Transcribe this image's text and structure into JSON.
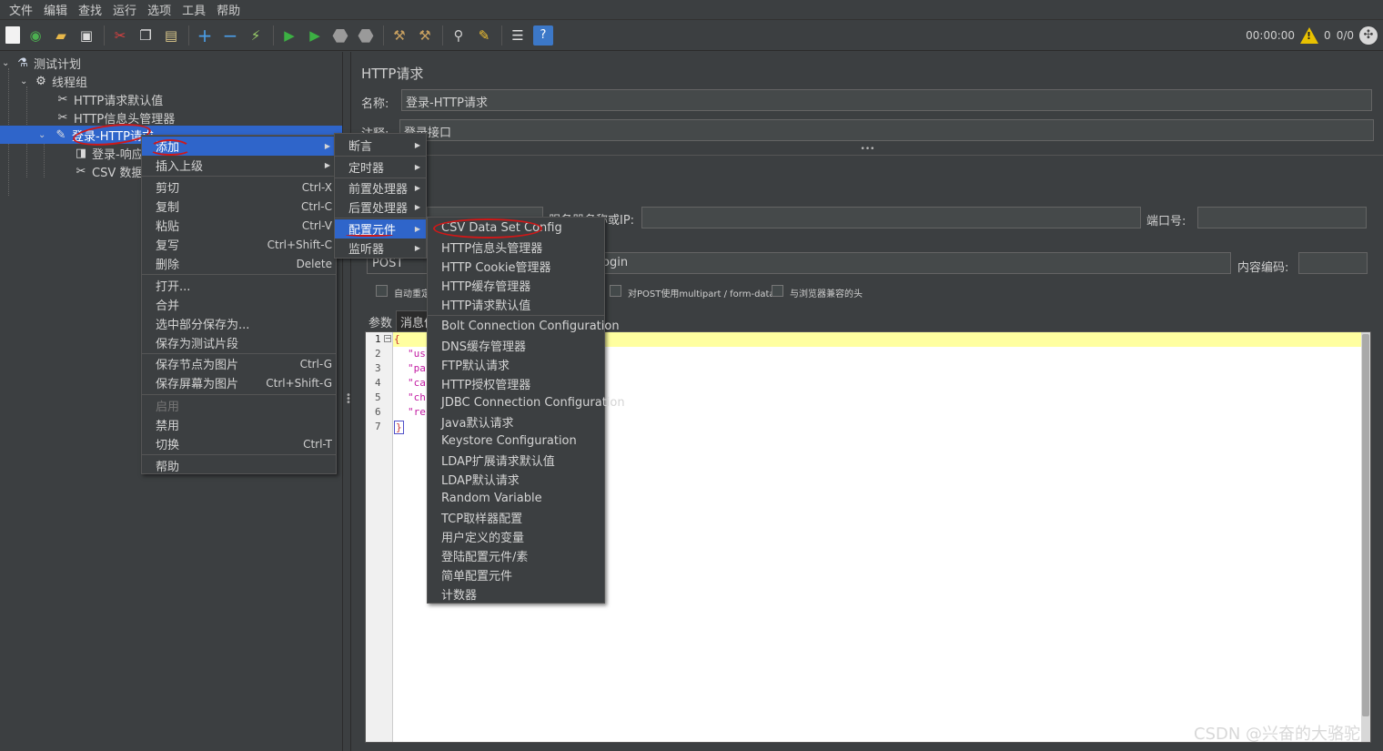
{
  "menubar": [
    "文件",
    "编辑",
    "查找",
    "运行",
    "选项",
    "工具",
    "帮助"
  ],
  "toolbar": {
    "icons": [
      "new-icon",
      "templates-icon",
      "open-icon",
      "save-icon",
      "cut-icon",
      "copy-icon",
      "paste-icon",
      "expand-icon",
      "collapse-icon",
      "toggle-icon",
      "start-icon",
      "start-no-pause-icon",
      "stop-icon",
      "shutdown-icon",
      "clear-icon",
      "clear-all-icon",
      "search-icon",
      "reset-search-icon",
      "function-helper-icon",
      "help-icon"
    ],
    "timer": "00:00:00",
    "warnings": "0",
    "threads": "0/0"
  },
  "tree": {
    "items": [
      {
        "label": "测试计划",
        "icon": "test-plan-icon"
      },
      {
        "label": "线程组",
        "icon": "gear-icon"
      },
      {
        "label": "HTTP请求默认值",
        "icon": "config-tools-icon"
      },
      {
        "label": "HTTP信息头管理器",
        "icon": "config-tools-icon"
      },
      {
        "label": "登录-HTTP请求",
        "icon": "sampler-pen-icon"
      },
      {
        "label": "登录-响应",
        "icon": "listener-icon"
      },
      {
        "label": "CSV 数据文",
        "icon": "config-tools-icon"
      }
    ]
  },
  "panel": {
    "title": "HTTP请求",
    "name_label": "名称:",
    "name_value": "登录-HTTP请求",
    "comment_label": "注释:",
    "comment_value": "登录接口",
    "server_label": "服务器名称或IP:",
    "port_label": "端口号:",
    "method_value": "POST",
    "path_value": "ogin",
    "encoding_label": "内容编码:",
    "auto_redirect_label": "自动重定",
    "multipart_label": "对POST使用multipart / form-data",
    "browser_headers_label": "与浏览器兼容的头",
    "tab_params": "参数",
    "tab_body": "消息体",
    "line_numbers": [
      "1",
      "2",
      "3",
      "4",
      "5",
      "6",
      "7"
    ],
    "code_lines": [
      "{",
      "\"us",
      "\"pa",
      "\"ca",
      "\"ch",
      "\"re",
      "}"
    ]
  },
  "context_menu": {
    "items": [
      {
        "label": "添加",
        "shortcut": "",
        "submenu": true
      },
      {
        "label": "插入上级",
        "shortcut": "",
        "submenu": true
      },
      {
        "label": "剪切",
        "shortcut": "Ctrl-X"
      },
      {
        "label": "复制",
        "shortcut": "Ctrl-C"
      },
      {
        "label": "粘贴",
        "shortcut": "Ctrl-V"
      },
      {
        "label": "复写",
        "shortcut": "Ctrl+Shift-C"
      },
      {
        "label": "删除",
        "shortcut": "Delete"
      },
      {
        "label": "打开...",
        "shortcut": ""
      },
      {
        "label": "合并",
        "shortcut": ""
      },
      {
        "label": "选中部分保存为...",
        "shortcut": ""
      },
      {
        "label": "保存为测试片段",
        "shortcut": ""
      },
      {
        "label": "保存节点为图片",
        "shortcut": "Ctrl-G"
      },
      {
        "label": "保存屏幕为图片",
        "shortcut": "Ctrl+Shift-G"
      },
      {
        "label": "启用",
        "shortcut": ""
      },
      {
        "label": "禁用",
        "shortcut": ""
      },
      {
        "label": "切换",
        "shortcut": "Ctrl-T"
      },
      {
        "label": "帮助",
        "shortcut": ""
      }
    ]
  },
  "add_submenu": {
    "items": [
      "断言",
      "定时器",
      "前置处理器",
      "后置处理器",
      "配置元件",
      "监听器"
    ]
  },
  "config_submenu": {
    "items": [
      "CSV Data Set Config",
      "HTTP信息头管理器",
      "HTTP Cookie管理器",
      "HTTP缓存管理器",
      "HTTP请求默认值",
      "Bolt Connection Configuration",
      "DNS缓存管理器",
      "FTP默认请求",
      "HTTP授权管理器",
      "JDBC Connection Configuration",
      "Java默认请求",
      "Keystore Configuration",
      "LDAP扩展请求默认值",
      "LDAP默认请求",
      "Random Variable",
      "TCP取样器配置",
      "用户定义的变量",
      "登陆配置元件/素",
      "简单配置元件",
      "计数器"
    ]
  },
  "watermark": "CSDN @兴奋的大骆驼"
}
